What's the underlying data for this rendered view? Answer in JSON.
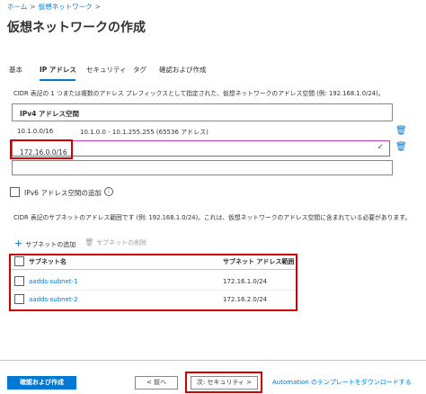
{
  "breadcrumb": {
    "home": "ホーム",
    "separator": ">",
    "current": "仮想ネットワーク",
    "trail_sep": ">"
  },
  "page": {
    "title": "仮想ネットワークの作成"
  },
  "tabs": [
    {
      "label": "基本"
    },
    {
      "label": "IP アドレス",
      "active": true
    },
    {
      "label": "セキュリティ"
    },
    {
      "label": "タグ"
    },
    {
      "label": "確認および作成"
    }
  ],
  "address_space": {
    "description": "CIDR 表記の 1 つまたは複数のアドレス プレフィックスとして指定された、仮想ネットワークのアドレス空間 (例: 192.168.1.0/24)。",
    "header": "IPv4 アドレス空間",
    "existing": {
      "cidr": "10.1.0.0/16",
      "range": "10.1.0.0 - 10.1.255.255 (65536 アドレス)"
    },
    "input_value": "172.16.0.0/16",
    "delete_icon": "trash-icon",
    "valid_icon": "checkmark-icon"
  },
  "ipv6": {
    "label": "IPv6 アドレス空間の追加",
    "info_glyph": "i"
  },
  "subnets": {
    "description": "CIDR 表記のサブネットのアドレス範囲です (例: 192.168.1.0/24)。これは、仮想ネットワークのアドレス空間に含まれている必要があります。",
    "add_label": "サブネットの追加",
    "delete_label": "サブネットの削除",
    "columns": [
      "サブネット名",
      "サブネット アドレス範囲"
    ],
    "rows": [
      {
        "name": "aadds-subnet-1",
        "range": "172.16.1.0/24"
      },
      {
        "name": "aadds-subnet-2",
        "range": "172.16.2.0/24"
      }
    ]
  },
  "footer": {
    "review_create": "確認および作成",
    "previous": "< 前へ",
    "next": "次: セキュリティ >",
    "automation_link": "Automation のテンプレートをダウンロードする"
  },
  "colors": {
    "accent": "#0078d4",
    "highlight": "#d40000",
    "valid": "#107c10"
  }
}
